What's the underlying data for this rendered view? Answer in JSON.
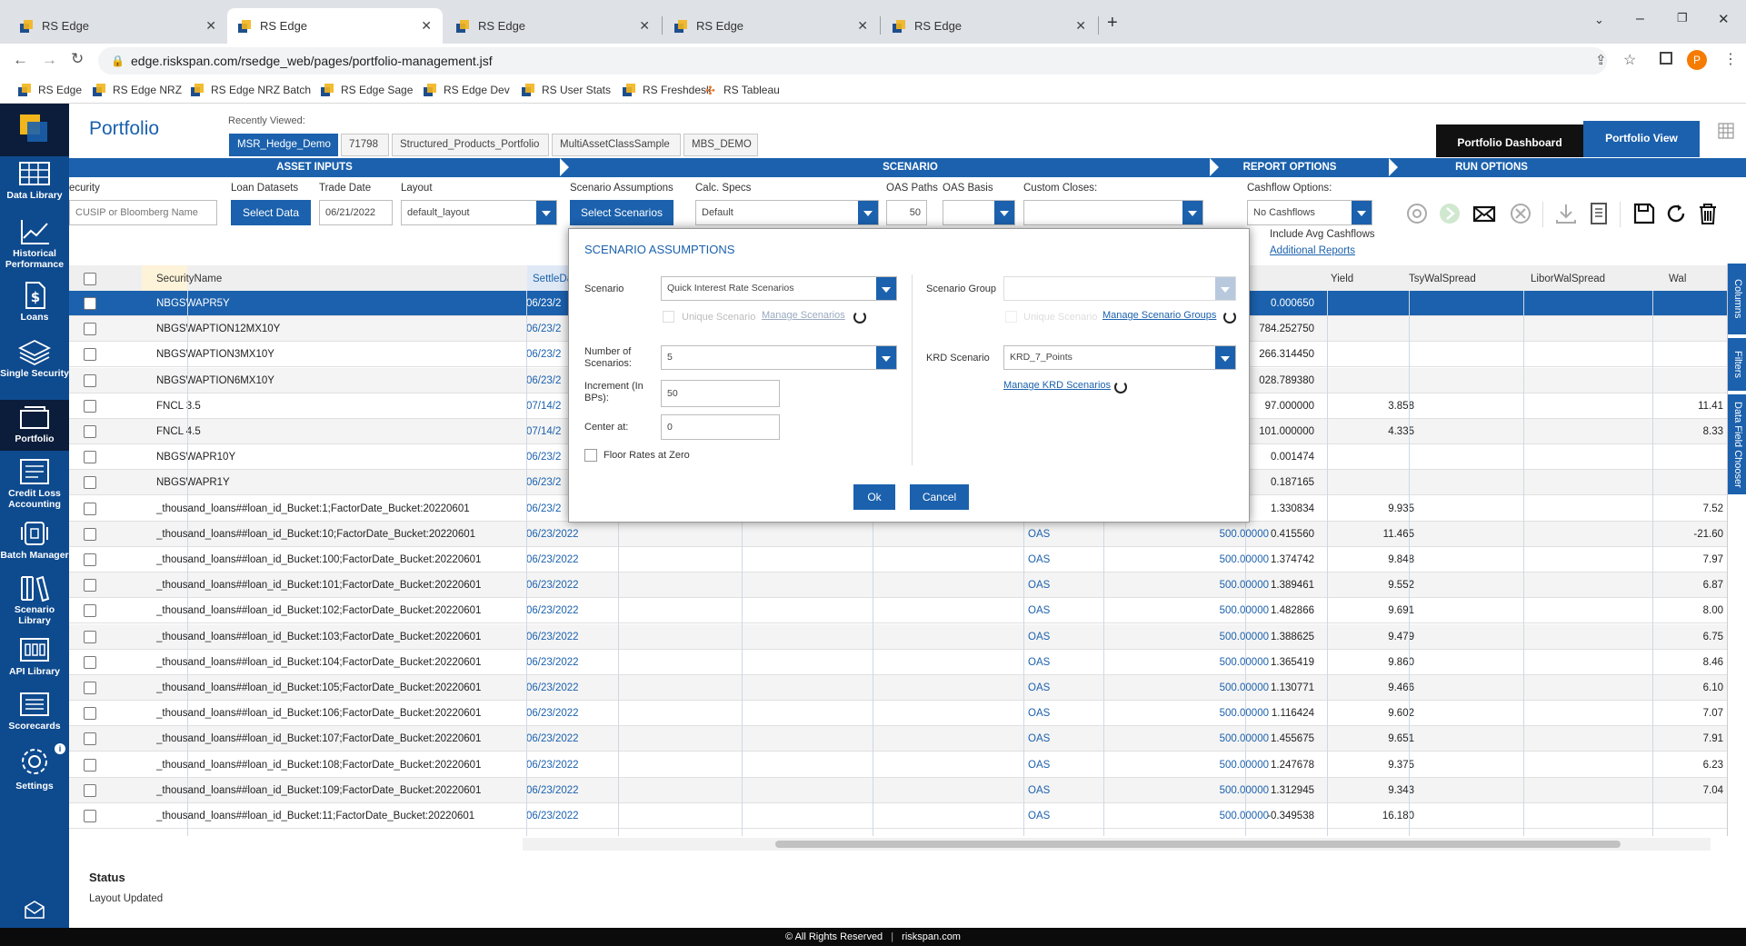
{
  "browser": {
    "tabs": [
      {
        "title": "RS Edge",
        "active": false
      },
      {
        "title": "RS Edge",
        "active": true
      },
      {
        "title": "RS Edge",
        "active": false
      },
      {
        "title": "RS Edge",
        "active": false
      },
      {
        "title": "RS Edge",
        "active": false
      }
    ],
    "url": "edge.riskspan.com/rsedge_web/pages/portfolio-management.jsf",
    "profile_initial": "P",
    "bookmarks": [
      "RS Edge",
      "RS Edge NRZ",
      "RS Edge NRZ Batch",
      "RS Edge Sage",
      "RS Edge Dev",
      "RS User Stats",
      "RS Freshdesk",
      "RS Tableau"
    ]
  },
  "sidebar": {
    "items": [
      {
        "label": "Data Library",
        "icon": "grid-icon"
      },
      {
        "label": "Historical Performance",
        "icon": "line-chart-icon"
      },
      {
        "label": "Loans",
        "icon": "dollar-doc-icon"
      },
      {
        "label": "Single Security",
        "icon": "layers-icon"
      },
      {
        "label": "Portfolio",
        "icon": "folder-icon",
        "active": true
      },
      {
        "label": "Credit Loss Accounting",
        "icon": "ledger-icon"
      },
      {
        "label": "Batch Manager",
        "icon": "batch-icon"
      },
      {
        "label": "Scenario Library",
        "icon": "books-icon"
      },
      {
        "label": "API Library",
        "icon": "api-icon"
      },
      {
        "label": "Scorecards",
        "icon": "scorecard-icon"
      },
      {
        "label": "Settings",
        "icon": "gear-icon"
      }
    ]
  },
  "header": {
    "title": "Portfolio",
    "recently_viewed_label": "Recently Viewed:",
    "recently_viewed": [
      "MSR_Hedge_Demo",
      "71798",
      "Structured_Products_Portfolio",
      "MultiAssetClassSample",
      "MBS_DEMO"
    ],
    "dashboard_button": "Portfolio Dashboard",
    "view_button": "Portfolio View"
  },
  "sections": [
    "ASSET INPUTS",
    "SCENARIO",
    "REPORT OPTIONS",
    "RUN OPTIONS"
  ],
  "inputs": {
    "security_label": "ecurity",
    "security_placeholder": "CUSIP or Bloomberg Name",
    "loan_datasets_label": "Loan Datasets",
    "select_data_button": "Select Data",
    "trade_date_label": "Trade Date",
    "trade_date_value": "06/21/2022",
    "layout_label": "Layout",
    "layout_value": "default_layout",
    "scenario_assumptions_label": "Scenario Assumptions",
    "select_scenarios_button": "Select Scenarios",
    "calc_specs_label": "Calc. Specs",
    "calc_specs_value": "Default",
    "oas_paths_label": "OAS Paths",
    "oas_paths_value": "50",
    "oas_basis_label": "OAS Basis",
    "custom_closes_label": "Custom Closes:",
    "cashflow_label": "Cashflow Options:",
    "cashflow_value": "No Cashflows",
    "include_avg_cashflows": "Include Avg Cashflows",
    "additional_reports": "Additional Reports"
  },
  "grid": {
    "headers": {
      "name": "SecurityName",
      "settle": "SettleDat",
      "yield": "Yield",
      "tsy": "TsyWalSpread",
      "libor": "LiborWalSpread",
      "wal": "Wal"
    },
    "rows": [
      {
        "name": "NBGSWAPR5Y",
        "settle": "06/23/2",
        "oas": "",
        "oasval": "",
        "price": "0.000650",
        "yield": "",
        "wal": ""
      },
      {
        "name": "NBGSWAPTION12MX10Y",
        "settle": "06/23/2",
        "oas": "",
        "oasval": "",
        "price": "784.252750",
        "yield": "",
        "wal": ""
      },
      {
        "name": "NBGSWAPTION3MX10Y",
        "settle": "06/23/2",
        "oas": "",
        "oasval": "",
        "price": "266.314450",
        "yield": "",
        "wal": ""
      },
      {
        "name": "NBGSWAPTION6MX10Y",
        "settle": "06/23/2",
        "oas": "",
        "oasval": "",
        "price": "028.789380",
        "yield": "",
        "wal": ""
      },
      {
        "name": "FNCL 3.5",
        "settle": "07/14/2",
        "oas": "",
        "oasval": "",
        "price": "97.000000",
        "yield": "3.858",
        "wal": "11.41"
      },
      {
        "name": "FNCL 4.5",
        "settle": "07/14/2",
        "oas": "",
        "oasval": "",
        "price": "101.000000",
        "yield": "4.335",
        "wal": "8.33"
      },
      {
        "name": "NBGSWAPR10Y",
        "settle": "06/23/2",
        "oas": "",
        "oasval": "",
        "price": "0.001474",
        "yield": "",
        "wal": ""
      },
      {
        "name": "NBGSWAPR1Y",
        "settle": "06/23/2",
        "oas": "",
        "oasval": "",
        "price": "0.187165",
        "yield": "",
        "wal": ""
      },
      {
        "name": "_thousand_loans##loan_id_Bucket:1;FactorDate_Bucket:20220601",
        "settle": "06/23/2",
        "oas": "",
        "oasval": "",
        "price": "1.330834",
        "yield": "9.935",
        "wal": "7.52"
      },
      {
        "name": "_thousand_loans##loan_id_Bucket:10;FactorDate_Bucket:20220601",
        "settle": "06/23/2022",
        "oas": "OAS",
        "oasval": "500.00000",
        "price": "0.415560",
        "yield": "11.465",
        "wal": "-21.60"
      },
      {
        "name": "_thousand_loans##loan_id_Bucket:100;FactorDate_Bucket:20220601",
        "settle": "06/23/2022",
        "oas": "OAS",
        "oasval": "500.00000",
        "price": "1.374742",
        "yield": "9.848",
        "wal": "7.97"
      },
      {
        "name": "_thousand_loans##loan_id_Bucket:101;FactorDate_Bucket:20220601",
        "settle": "06/23/2022",
        "oas": "OAS",
        "oasval": "500.00000",
        "price": "1.389461",
        "yield": "9.552",
        "wal": "6.87"
      },
      {
        "name": "_thousand_loans##loan_id_Bucket:102;FactorDate_Bucket:20220601",
        "settle": "06/23/2022",
        "oas": "OAS",
        "oasval": "500.00000",
        "price": "1.482866",
        "yield": "9.691",
        "wal": "8.00"
      },
      {
        "name": "_thousand_loans##loan_id_Bucket:103;FactorDate_Bucket:20220601",
        "settle": "06/23/2022",
        "oas": "OAS",
        "oasval": "500.00000",
        "price": "1.388625",
        "yield": "9.479",
        "wal": "6.75"
      },
      {
        "name": "_thousand_loans##loan_id_Bucket:104;FactorDate_Bucket:20220601",
        "settle": "06/23/2022",
        "oas": "OAS",
        "oasval": "500.00000",
        "price": "1.365419",
        "yield": "9.860",
        "wal": "8.46"
      },
      {
        "name": "_thousand_loans##loan_id_Bucket:105;FactorDate_Bucket:20220601",
        "settle": "06/23/2022",
        "oas": "OAS",
        "oasval": "500.00000",
        "price": "1.130771",
        "yield": "9.466",
        "wal": "6.10"
      },
      {
        "name": "_thousand_loans##loan_id_Bucket:106;FactorDate_Bucket:20220601",
        "settle": "06/23/2022",
        "oas": "OAS",
        "oasval": "500.00000",
        "price": "1.116424",
        "yield": "9.602",
        "wal": "7.07"
      },
      {
        "name": "_thousand_loans##loan_id_Bucket:107;FactorDate_Bucket:20220601",
        "settle": "06/23/2022",
        "oas": "OAS",
        "oasval": "500.00000",
        "price": "1.455675",
        "yield": "9.651",
        "wal": "7.91"
      },
      {
        "name": "_thousand_loans##loan_id_Bucket:108;FactorDate_Bucket:20220601",
        "settle": "06/23/2022",
        "oas": "OAS",
        "oasval": "500.00000",
        "price": "1.247678",
        "yield": "9.375",
        "wal": "6.23"
      },
      {
        "name": "_thousand_loans##loan_id_Bucket:109;FactorDate_Bucket:20220601",
        "settle": "06/23/2022",
        "oas": "OAS",
        "oasval": "500.00000",
        "price": "1.312945",
        "yield": "9.343",
        "wal": "7.04"
      },
      {
        "name": "_thousand_loans##loan_id_Bucket:11;FactorDate_Bucket:20220601",
        "settle": "06/23/2022",
        "oas": "OAS",
        "oasval": "500.00000",
        "price": "-0.349538",
        "yield": "16.180",
        "wal": ""
      }
    ]
  },
  "right_strip": [
    "Columns",
    "Filters",
    "Data Field Chooser"
  ],
  "modal": {
    "title": "SCENARIO ASSUMPTIONS",
    "scenario_label": "Scenario",
    "scenario_value": "Quick Interest Rate Scenarios",
    "unique_scenario": "Unique Scenario",
    "manage_scenarios": "Manage Scenarios",
    "num_scenarios_label": "Number of Scenarios:",
    "num_scenarios_value": "5",
    "increment_label": "Increment (In BPs):",
    "increment_value": "50",
    "center_label": "Center at:",
    "center_value": "0",
    "floor_rates": "Floor Rates at Zero",
    "scenario_group_label": "Scenario Group",
    "unique_scenario_right": "Unique Scenario",
    "manage_scenario_groups": "Manage Scenario Groups",
    "krd_label": "KRD Scenario",
    "krd_value": "KRD_7_Points",
    "manage_krd": "Manage KRD Scenarios",
    "ok": "Ok",
    "cancel": "Cancel"
  },
  "status": {
    "title": "Status",
    "message": "Layout Updated"
  },
  "footer": {
    "copyright": "© All Rights Reserved",
    "site": "riskspan.com"
  },
  "colors": {
    "primary": "#1b61ad",
    "sidebar": "#0e4a8e",
    "dark": "#0b1d3a"
  }
}
